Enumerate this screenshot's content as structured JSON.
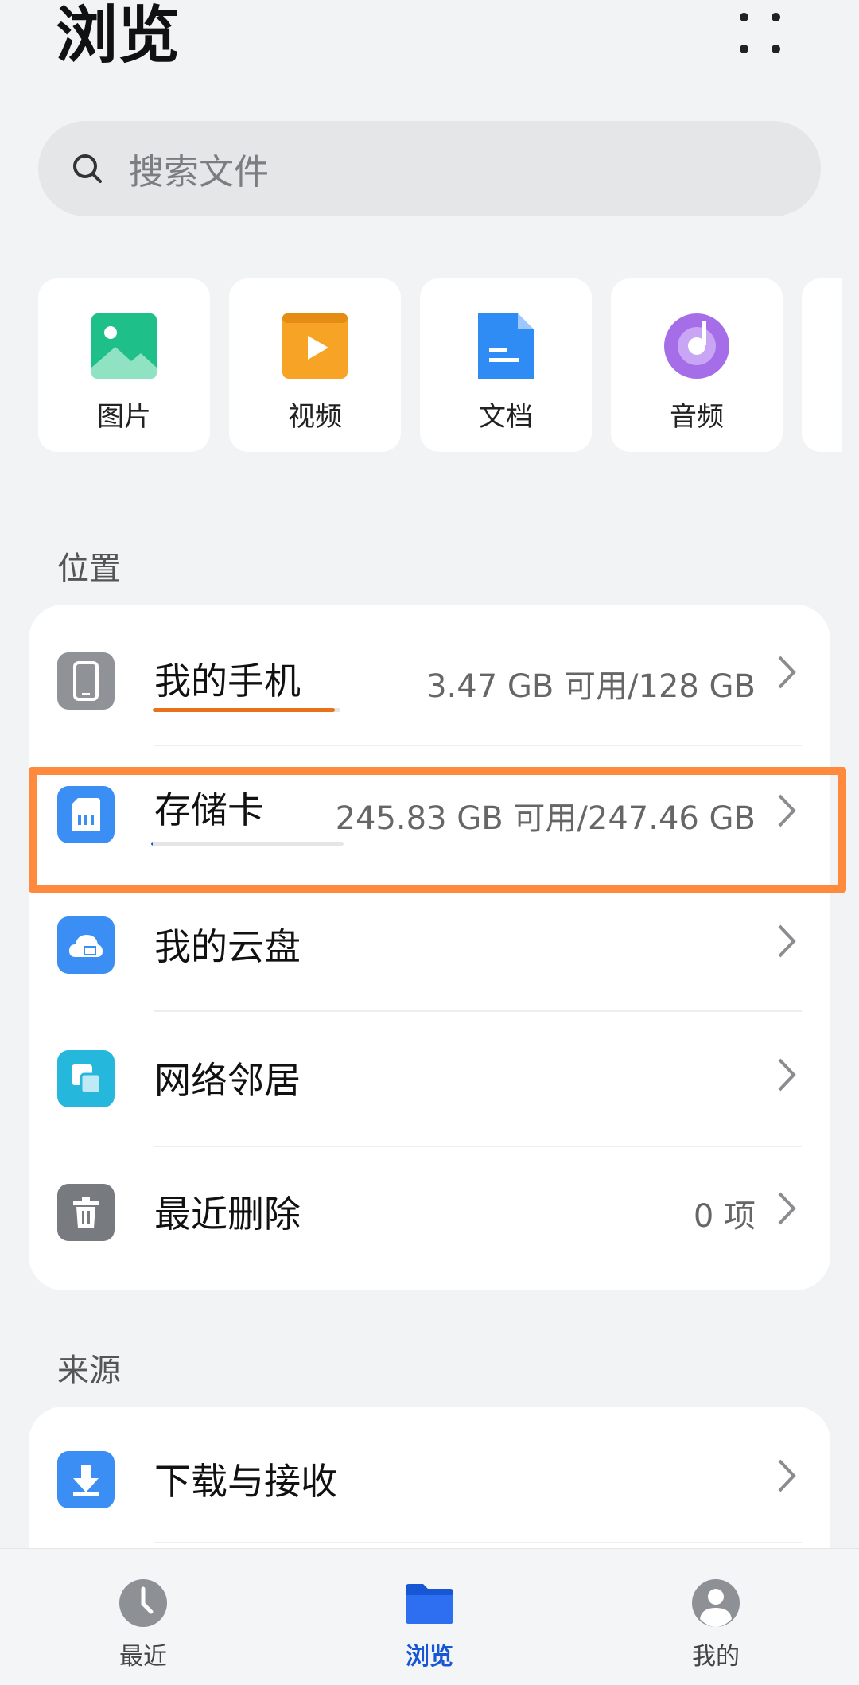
{
  "header": {
    "title": "浏览"
  },
  "search": {
    "placeholder": "搜索文件"
  },
  "categories": [
    {
      "label": "图片",
      "icon": "image-icon"
    },
    {
      "label": "视频",
      "icon": "video-icon"
    },
    {
      "label": "文档",
      "icon": "document-icon"
    },
    {
      "label": "音频",
      "icon": "audio-icon"
    }
  ],
  "locations": {
    "label": "位置",
    "items": [
      {
        "title": "我的手机",
        "value": "3.47 GB 可用/128 GB",
        "icon": "phone-icon",
        "usage": 0.97,
        "color": "#e8711c"
      },
      {
        "title": "存储卡",
        "value": "245.83 GB 可用/247.46 GB",
        "icon": "sd-card-icon",
        "usage": 0.007,
        "color": "#1757d6"
      },
      {
        "title": "我的云盘",
        "value": "",
        "icon": "cloud-icon"
      },
      {
        "title": "网络邻居",
        "value": "",
        "icon": "network-icon"
      },
      {
        "title": "最近删除",
        "value": "0 项",
        "icon": "trash-icon"
      }
    ]
  },
  "sources": {
    "label": "来源",
    "items": [
      {
        "title": "下载与接收",
        "value": "",
        "icon": "download-icon"
      }
    ]
  },
  "tabs": [
    {
      "label": "最近",
      "icon": "clock-icon",
      "active": false
    },
    {
      "label": "浏览",
      "icon": "folder-icon",
      "active": true
    },
    {
      "label": "我的",
      "icon": "user-icon",
      "active": false
    }
  ],
  "colors": {
    "accent": "#1757d6",
    "highlight": "#ff8a3d"
  }
}
